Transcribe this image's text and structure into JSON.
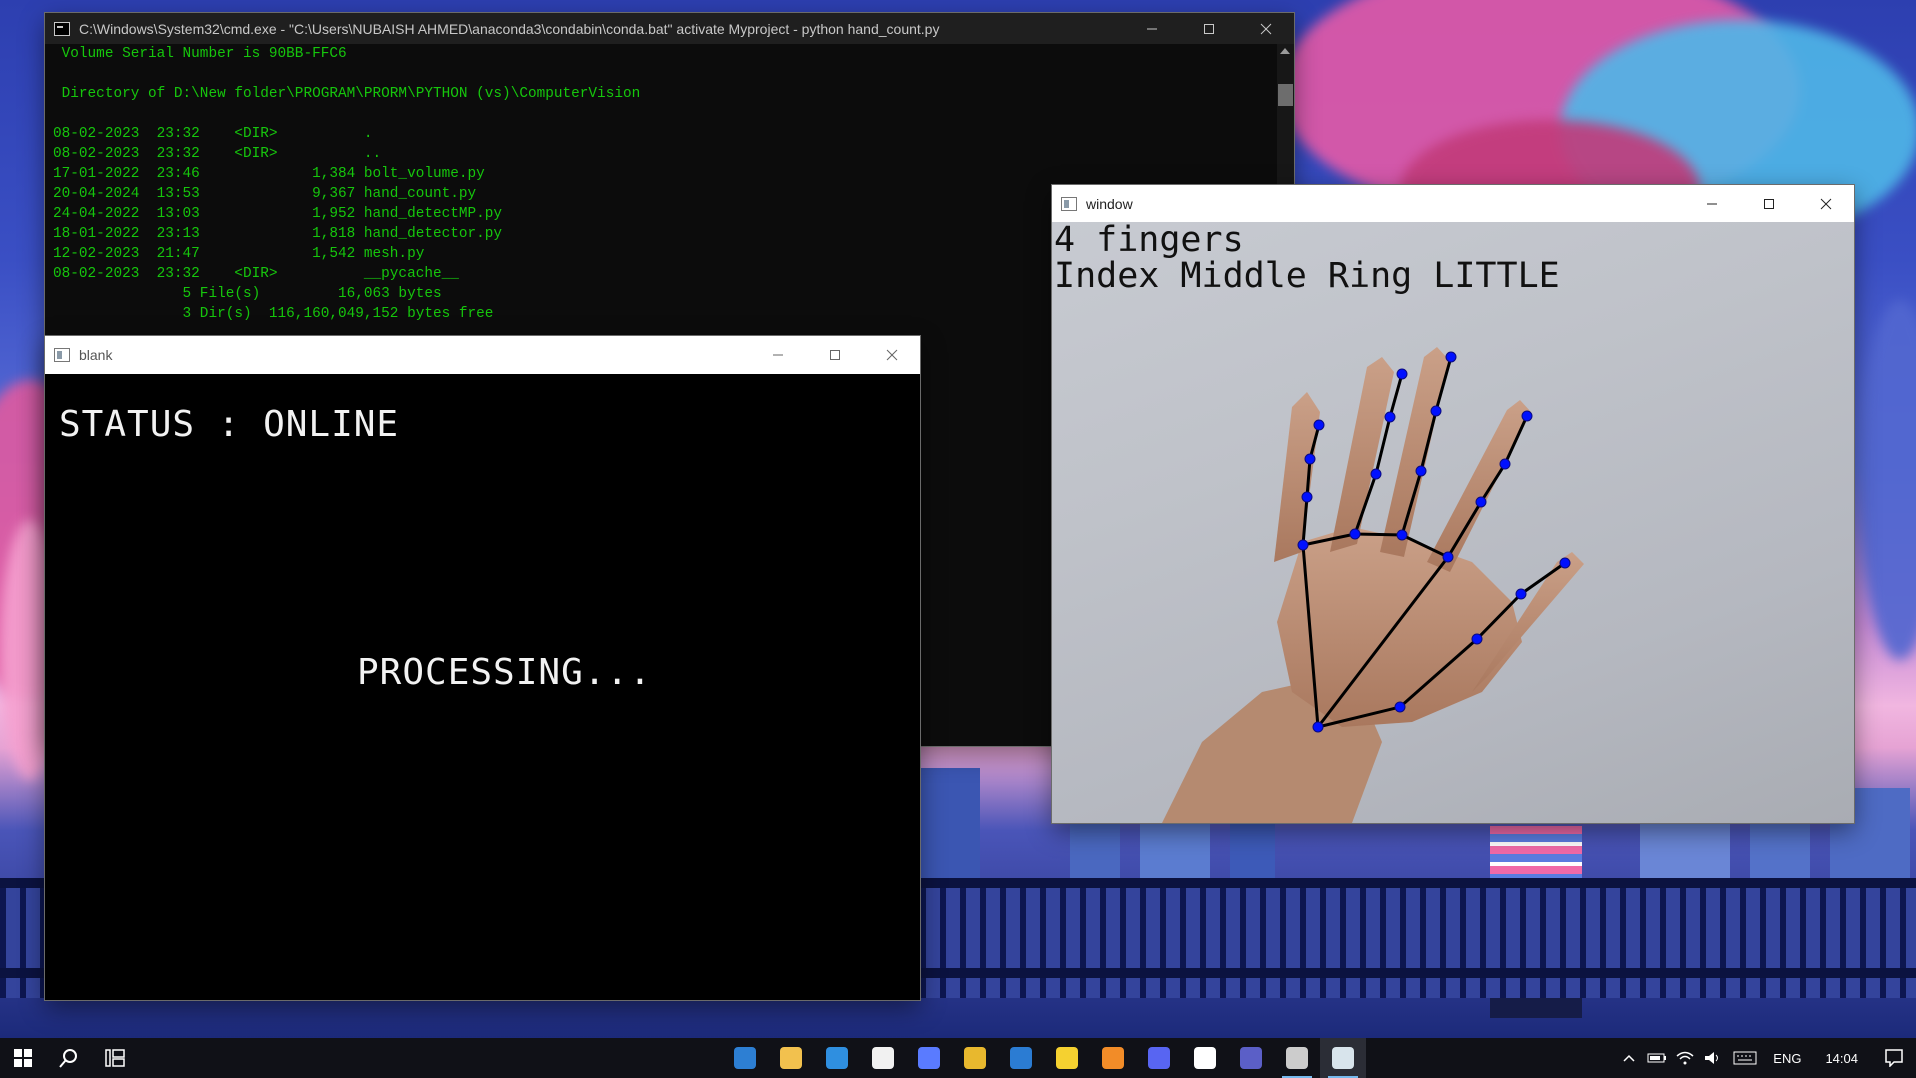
{
  "cmd_window": {
    "title": "C:\\Windows\\System32\\cmd.exe - \"C:\\Users\\NUBAISH AHMED\\anaconda3\\condabin\\conda.bat\"  activate Myproject - python  hand_count.py",
    "lines": [
      " Volume Serial Number is 90BB-FFC6",
      "",
      " Directory of D:\\New folder\\PROGRAM\\PRORM\\PYTHON (vs)\\ComputerVision",
      "",
      "08-02-2023  23:32    <DIR>          .",
      "08-02-2023  23:32    <DIR>          ..",
      "17-01-2022  23:46             1,384 bolt_volume.py",
      "20-04-2024  13:53             9,367 hand_count.py",
      "24-04-2022  13:03             1,952 hand_detectMP.py",
      "18-01-2022  23:13             1,818 hand_detector.py",
      "12-02-2023  21:47             1,542 mesh.py",
      "08-02-2023  23:32    <DIR>          __pycache__",
      "               5 File(s)         16,063 bytes",
      "               3 Dir(s)  116,160,049,152 bytes free"
    ],
    "text_color": "#16c60c"
  },
  "blank_window": {
    "title": "blank",
    "status_text": "STATUS : ONLINE",
    "processing_text": "PROCESSING..."
  },
  "camera_window": {
    "title": "window",
    "finger_count_text": "4 fingers",
    "finger_names_text": "Index Middle Ring LITTLE",
    "landmark_color": "#0010ff"
  },
  "taskbar": {
    "start_icon": "windows-logo-icon",
    "search_icon": "search-icon",
    "task_view_icon": "task-view-icon",
    "apps": [
      {
        "name": "remote-desktop-icon",
        "color": "#2d7fd3"
      },
      {
        "name": "file-explorer-icon",
        "color": "#f2c14e"
      },
      {
        "name": "mail-icon",
        "color": "#2f8fe0"
      },
      {
        "name": "microsoft-store-icon",
        "color": "#f1f1f1"
      },
      {
        "name": "photos-icon",
        "color": "#5a7bff"
      },
      {
        "name": "chrome-icon",
        "color": "#e8b82e"
      },
      {
        "name": "todo-icon",
        "color": "#2b7cd3"
      },
      {
        "name": "sticky-notes-icon",
        "color": "#f5d130"
      },
      {
        "name": "search-tool-icon",
        "color": "#f28c28"
      },
      {
        "name": "discord-icon",
        "color": "#5865f2"
      },
      {
        "name": "xbox-icon",
        "color": "#ffffff"
      },
      {
        "name": "teams-icon",
        "color": "#5b5fc7"
      },
      {
        "name": "command-prompt-icon",
        "color": "#cccccc"
      },
      {
        "name": "python-window-icon",
        "color": "#d8e4ec"
      }
    ],
    "language": "ENG",
    "time": "14:04"
  }
}
